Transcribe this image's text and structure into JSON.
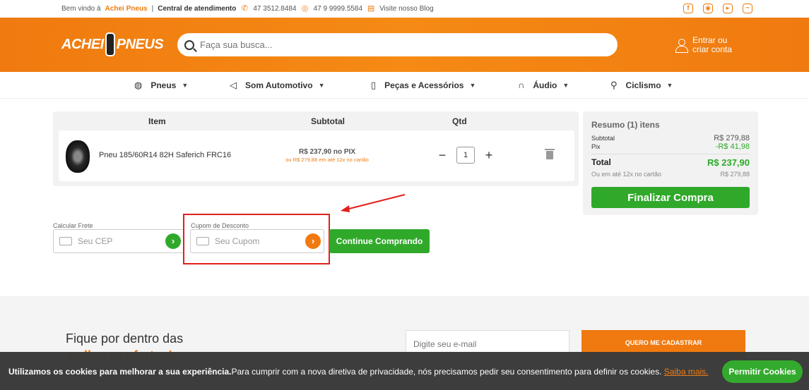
{
  "topbar": {
    "welcome": "Bem vindo à",
    "brand": "Achei Pneus",
    "support_label": "Central de atendimento",
    "phone": "47 3512.8484",
    "whatsapp": "47 9 9999.5584",
    "blog": "Visite nosso Blog"
  },
  "header": {
    "logo_left": "ACHEI",
    "logo_right": "PNEUS",
    "search_placeholder": "Faça sua busca...",
    "login_line1": "Entrar ou",
    "login_line2": "criar conta"
  },
  "nav": {
    "items": [
      {
        "label": "Pneus"
      },
      {
        "label": "Som Automotivo"
      },
      {
        "label": "Peças e Acessórios"
      },
      {
        "label": "Áudio"
      },
      {
        "label": "Ciclismo"
      }
    ]
  },
  "cart": {
    "headers": {
      "item": "Item",
      "subtotal": "Subtotal",
      "qty": "Qtd"
    },
    "items": [
      {
        "name": "Pneu 185/60R14 82H Saferich FRC16",
        "price_pix": "R$ 237,90 no PIX",
        "price_card": "ou R$ 279,88 em até 12x no cartão",
        "quantity": "1"
      }
    ]
  },
  "summary": {
    "title": "Resumo (1) itens",
    "subtotal_label": "Subtotal",
    "subtotal_value": "R$ 279,88",
    "pix_label": "Pix",
    "pix_value": "-R$ 41,98",
    "total_label": "Total",
    "total_value": "R$ 237,90",
    "installments_label": "Ou em até 12x no cartão",
    "installments_value": "R$ 279,88",
    "finalize_label": "Finalizar Compra"
  },
  "shipping": {
    "label": "Calcular Frete",
    "placeholder": "Seu CEP"
  },
  "coupon": {
    "label": "Cupom de Desconto",
    "placeholder": "Seu Cupom"
  },
  "continue_label": "Continue Comprando",
  "newsletter": {
    "title": "Fique por dentro das",
    "subtitle": "melhores ofertas!",
    "email_placeholder": "Digite seu e-mail",
    "button": "QUERO ME CADASTRAR"
  },
  "cookies": {
    "bold": "Utilizamos os cookies para melhorar a sua experiência.",
    "text": "Para cumprir com a nova diretiva de privacidade, nós precisamos pedir seu consentimento para definir os cookies.",
    "link": "Saiba mais.",
    "button": "Permitir Cookies"
  },
  "colors": {
    "accent": "#f07a10",
    "green": "#30a92a",
    "highlight": "#e0201c"
  }
}
